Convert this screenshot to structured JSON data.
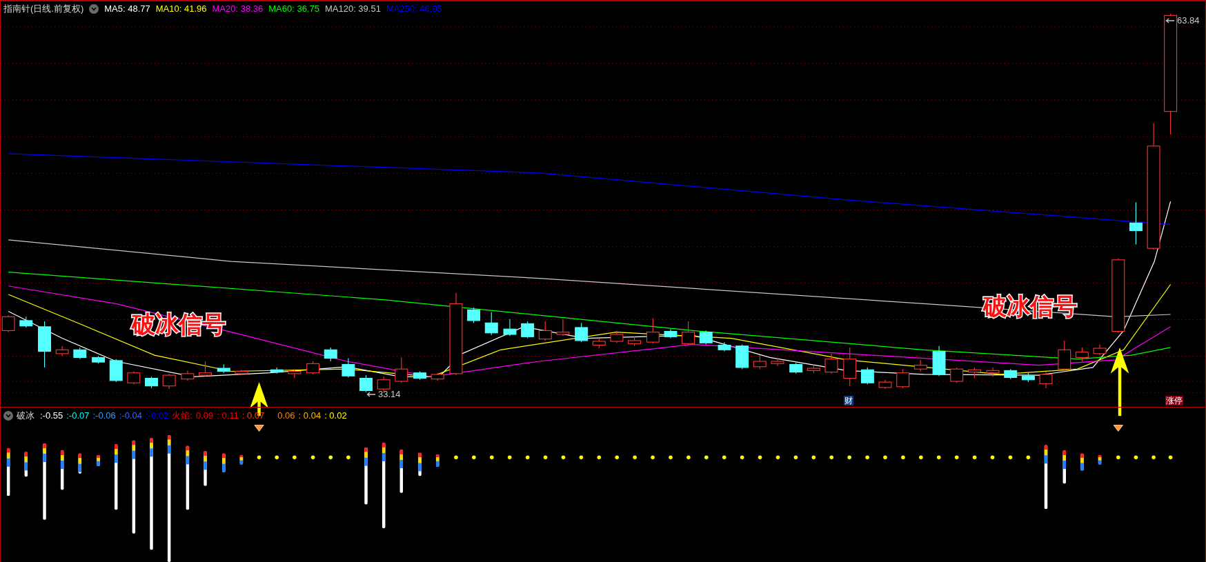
{
  "main_chart": {
    "title": "指南针(日线.前复权)",
    "moving_averages": [
      {
        "label": "MA5: 48.77",
        "color": "#ffffff"
      },
      {
        "label": "MA10: 41.96",
        "color": "#ffff00"
      },
      {
        "label": "MA20: 38.36",
        "color": "#ff00ff"
      },
      {
        "label": "MA60: 36.75",
        "color": "#00ff00"
      },
      {
        "label": "MA120: 39.51",
        "color": "#c8c8c8"
      },
      {
        "label": "MA250: 46.95",
        "color": "#0000ff"
      }
    ],
    "high_price": "63.84",
    "low_price": "33.14",
    "markers": [
      {
        "text": "财",
        "kind": "finance"
      },
      {
        "text": "涨停",
        "kind": "limit_up"
      }
    ],
    "signals": [
      "破冰信号",
      "破冰信号"
    ]
  },
  "indicator": {
    "name": "破冰",
    "values": [
      {
        "text": ":-0.55",
        "color": "#ffffff"
      },
      {
        "text": ":-0.07",
        "color": "#00ffff"
      },
      {
        "text": ":-0.06",
        "color": "#3399ff"
      },
      {
        "text": ":-0.04",
        "color": "#3366ff"
      },
      {
        "text": ":-0.02",
        "color": "#0000ff"
      }
    ],
    "flame_label": "火焰:",
    "flame_values": [
      {
        "text": "0.09",
        "color": "#ff0000"
      },
      {
        "text": ": 0.11",
        "color": "#ff0000"
      },
      {
        "text": ": 0.07",
        "color": "#ff4400"
      },
      {
        "text": "0.06",
        "color": "#ff8800"
      },
      {
        "text": ": 0.04",
        "color": "#ffbb00"
      },
      {
        "text": ": 0.02",
        "color": "#ffff00"
      }
    ]
  }
}
